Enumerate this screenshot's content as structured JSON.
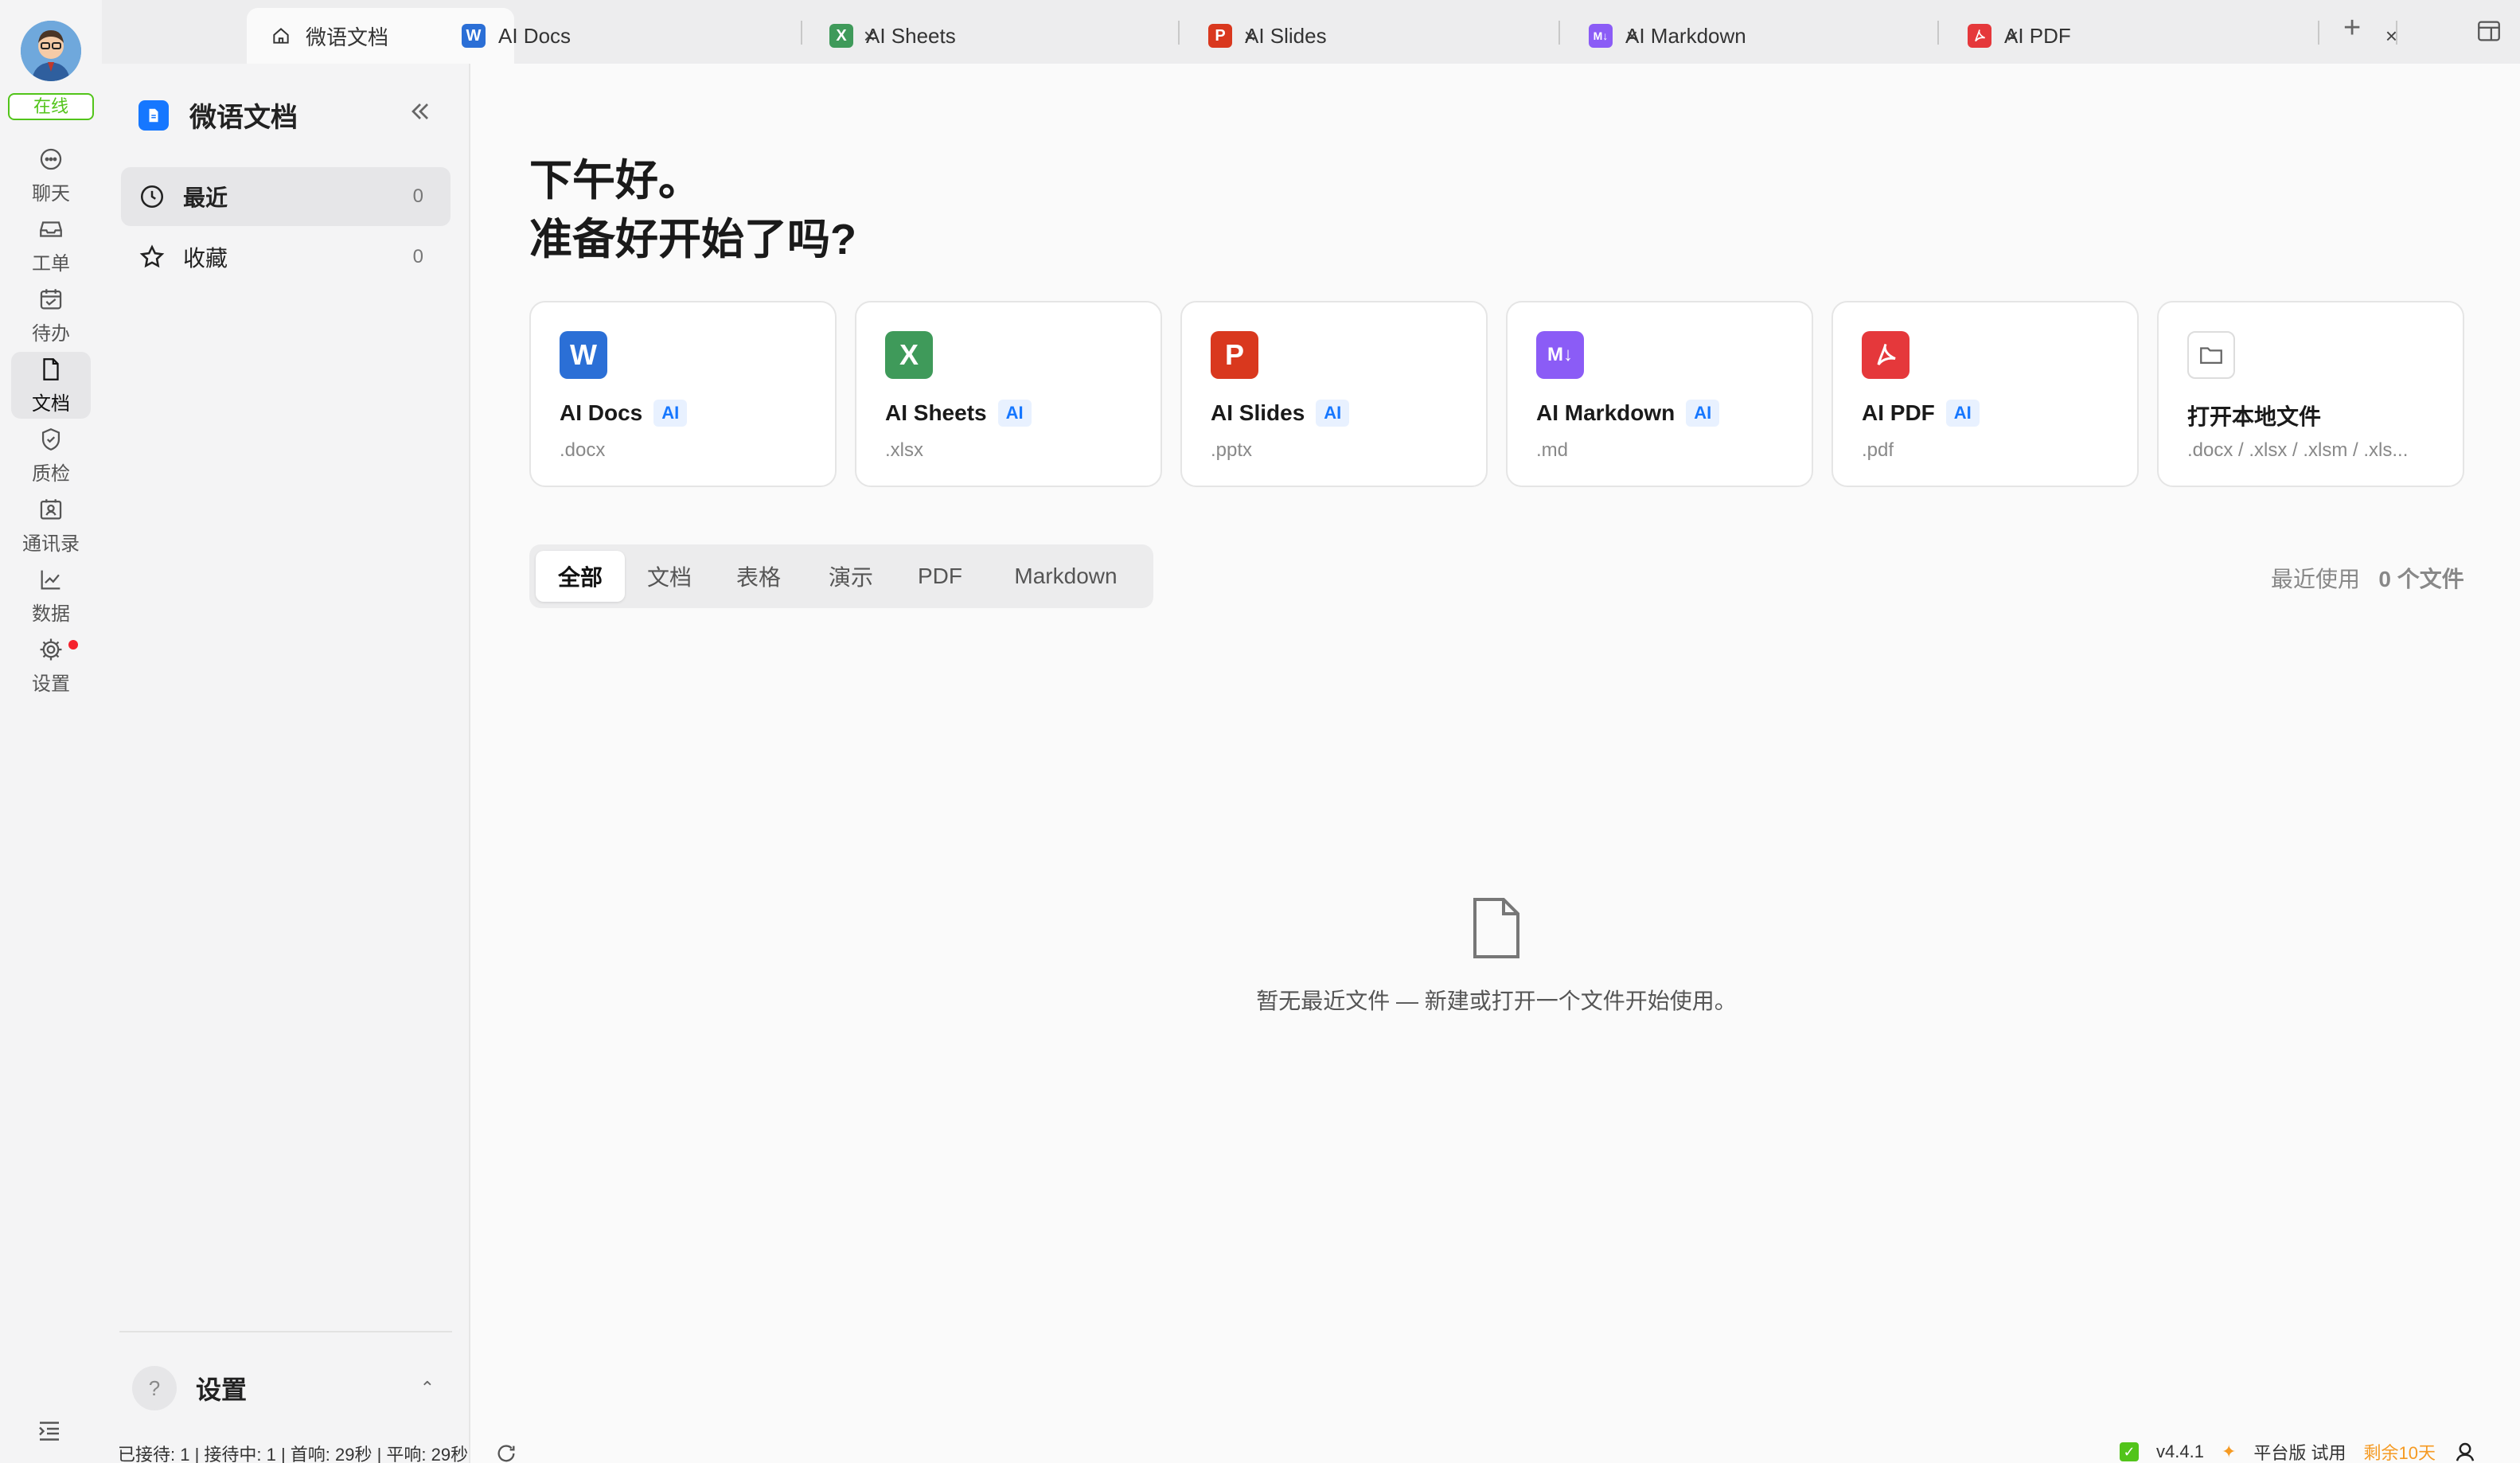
{
  "rail": {
    "status": "在线",
    "items": [
      {
        "label": "聊天",
        "icon": "chat-icon"
      },
      {
        "label": "工单",
        "icon": "inbox-icon"
      },
      {
        "label": "待办",
        "icon": "calendar-icon"
      },
      {
        "label": "文档",
        "icon": "document-icon"
      },
      {
        "label": "质检",
        "icon": "shield-check-icon"
      },
      {
        "label": "通讯录",
        "icon": "contacts-icon"
      },
      {
        "label": "数据",
        "icon": "chart-icon"
      },
      {
        "label": "设置",
        "icon": "gear-icon"
      }
    ]
  },
  "tabs": [
    {
      "label": "微语文档",
      "icon": "home-icon"
    },
    {
      "label": "AI Docs",
      "icon_letter": "W",
      "color": "#2b6fd6"
    },
    {
      "label": "AI Sheets",
      "icon_letter": "X",
      "color": "#3f9a5a"
    },
    {
      "label": "AI Slides",
      "icon_letter": "P",
      "color": "#d9381e"
    },
    {
      "label": "AI Markdown",
      "icon_letter": "M↓",
      "color": "#8b5cf6"
    },
    {
      "label": "AI PDF",
      "icon_letter": "A",
      "color": "#e5383b"
    }
  ],
  "tab_close": "×",
  "tab_add": "+",
  "sidebar": {
    "title": "微语文档",
    "items": [
      {
        "label": "最近",
        "count": "0"
      },
      {
        "label": "收藏",
        "count": "0"
      }
    ],
    "settings": {
      "label": "设置",
      "help": "?",
      "caret": "⌃"
    }
  },
  "main": {
    "greeting_line1": "下午好。",
    "greeting_line2": "准备好开始了吗?",
    "ai_badge": "AI",
    "cards": [
      {
        "name": "AI Docs",
        "ext": ".docx",
        "letter": "W",
        "color": "#2b6fd6"
      },
      {
        "name": "AI Sheets",
        "ext": ".xlsx",
        "letter": "X",
        "color": "#3f9a5a"
      },
      {
        "name": "AI Slides",
        "ext": ".pptx",
        "letter": "P",
        "color": "#d9381e"
      },
      {
        "name": "AI Markdown",
        "ext": ".md",
        "letter": "M↓",
        "color": "#8b5cf6"
      },
      {
        "name": "AI PDF",
        "ext": ".pdf",
        "letter": "A",
        "color": "#e5383b"
      },
      {
        "name": "打开本地文件",
        "ext": ".docx / .xlsx / .xlsm / .xls..."
      }
    ],
    "filters": [
      "全部",
      "文档",
      "表格",
      "演示",
      "PDF",
      "Markdown"
    ],
    "active_filter": "全部",
    "recent_label": "最近使用",
    "recent_count": "0 个文件",
    "empty_text": "暂无最近文件 — 新建或打开一个文件开始使用。"
  },
  "status": {
    "left": "已接待: 1 | 接待中: 1 | 首响: 29秒 | 平响: 29秒",
    "version": "v4.4.1",
    "plan": "平台版 试用",
    "remaining": "剩余10天"
  }
}
